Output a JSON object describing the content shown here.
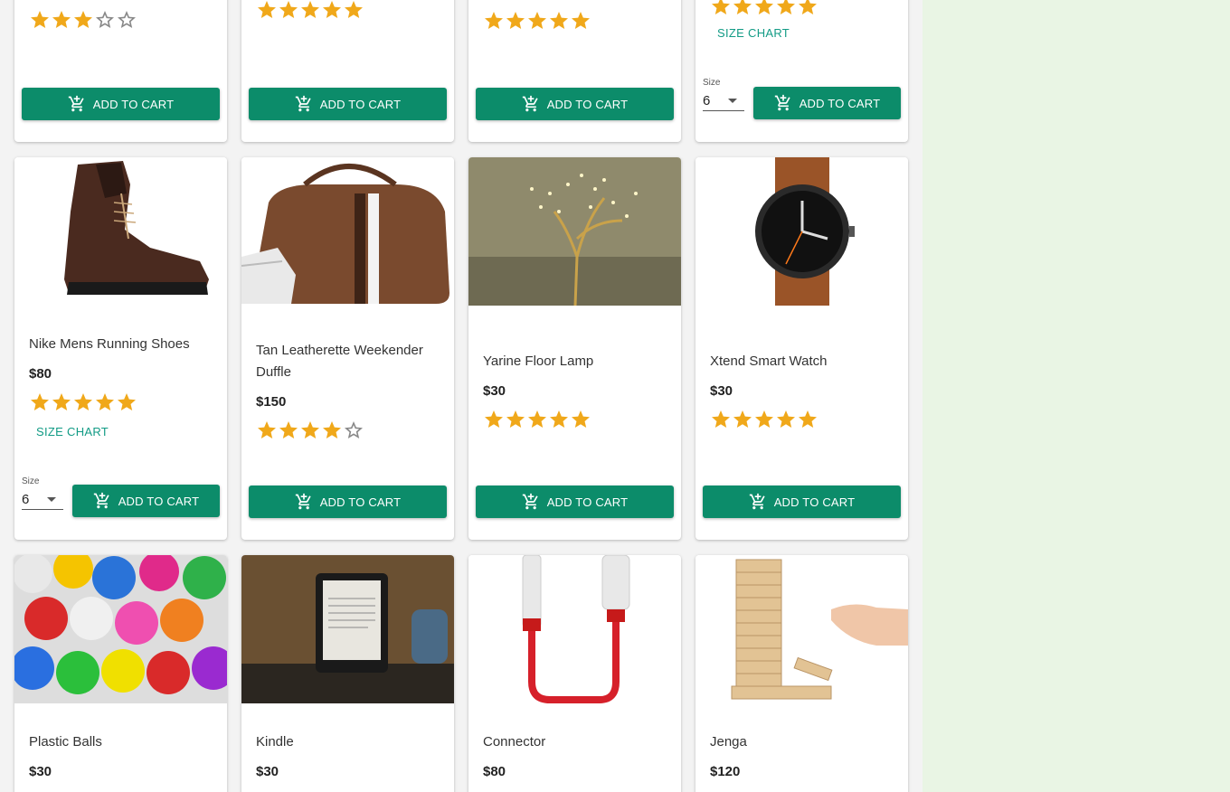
{
  "colors": {
    "accent": "#0c8c6a",
    "size_chart": "#129b85",
    "star": "#f0a81a",
    "panel": "#e9f5e4"
  },
  "icons": {
    "cart": "add-shopping-cart-icon",
    "star_filled": "star-icon",
    "star_empty": "star-outline-icon"
  },
  "cart_label": "ADD TO CART",
  "size_chart_label": "SIZE CHART",
  "size_label": "Size",
  "products": [
    {
      "name": "",
      "price": "",
      "rating": 3
    },
    {
      "name": "",
      "price": "",
      "rating": 5
    },
    {
      "name": "",
      "price": "",
      "rating": 5
    },
    {
      "name": "",
      "price": "",
      "rating": 5,
      "size": "6"
    },
    {
      "name": "Nike Mens Running Shoes",
      "price": "$80",
      "rating": 5,
      "size": "6"
    },
    {
      "name": "Tan Leatherette Weekender Duffle",
      "price": "$150",
      "rating": 4
    },
    {
      "name": "Yarine Floor Lamp",
      "price": "$30",
      "rating": 5
    },
    {
      "name": "Xtend Smart Watch",
      "price": "$30",
      "rating": 5
    },
    {
      "name": "Plastic Balls",
      "price": "$30"
    },
    {
      "name": "Kindle",
      "price": "$30"
    },
    {
      "name": "Connector",
      "price": "$80"
    },
    {
      "name": "Jenga",
      "price": "$120"
    }
  ]
}
